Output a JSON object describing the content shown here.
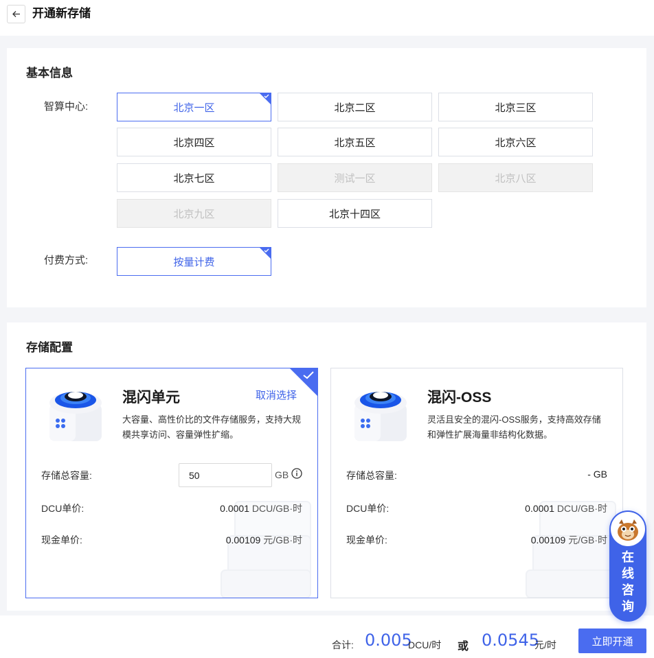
{
  "header": {
    "title": "开通新存储",
    "back_icon": "arrow-left-icon"
  },
  "basic": {
    "section_title": "基本信息",
    "center_label": "智算中心:",
    "centers": [
      {
        "label": "北京一区",
        "state": "selected"
      },
      {
        "label": "北京二区",
        "state": "normal"
      },
      {
        "label": "北京三区",
        "state": "normal"
      },
      {
        "label": "北京四区",
        "state": "normal"
      },
      {
        "label": "北京五区",
        "state": "normal"
      },
      {
        "label": "北京六区",
        "state": "normal"
      },
      {
        "label": "北京七区",
        "state": "normal"
      },
      {
        "label": "测试一区",
        "state": "disabled"
      },
      {
        "label": "北京八区",
        "state": "disabled"
      },
      {
        "label": "北京九区",
        "state": "disabled"
      },
      {
        "label": "北京十四区",
        "state": "normal"
      }
    ],
    "billing_label": "付费方式:",
    "billing": {
      "label": "按量计费",
      "state": "selected"
    }
  },
  "storage": {
    "section_title": "存储配置",
    "cards": [
      {
        "title": "混闪单元",
        "selected": true,
        "cancel_label": "取消选择",
        "desc": "大容量、高性价比的文件存储服务，支持大规模共享访问、容量弹性扩缩。",
        "capacity_label": "存储总容量:",
        "capacity_value": "50",
        "capacity_unit": "GB",
        "dcu_label": "DCU单价:",
        "dcu_value": "0.0001",
        "dcu_unit": "DCU/GB·时",
        "cash_label": "现金单价:",
        "cash_value": "0.00109",
        "cash_unit": "元/GB·时"
      },
      {
        "title": "混闪-OSS",
        "selected": false,
        "desc": "灵活且安全的混闪-OSS服务，支持高效存储和弹性扩展海量非结构化数据。",
        "capacity_label": "存储总容量:",
        "capacity_value": "- GB",
        "dcu_label": "DCU单价:",
        "dcu_value": "0.0001",
        "dcu_unit": "DCU/GB·时",
        "cash_label": "现金单价:",
        "cash_value": "0.00109",
        "cash_unit": "元/GB·时"
      }
    ]
  },
  "footer": {
    "sum_label": "合计:",
    "dcu_total": "0.005",
    "dcu_unit": "DCU/时",
    "or_label": "或",
    "cash_total": "0.0545",
    "cash_unit": "元/时",
    "submit_label": "立即开通"
  },
  "consult": {
    "label": "在线咨询"
  },
  "colors": {
    "primary": "#4a6cf0",
    "disabled_bg": "#f2f2f2",
    "page_bg": "#f4f5f8"
  }
}
